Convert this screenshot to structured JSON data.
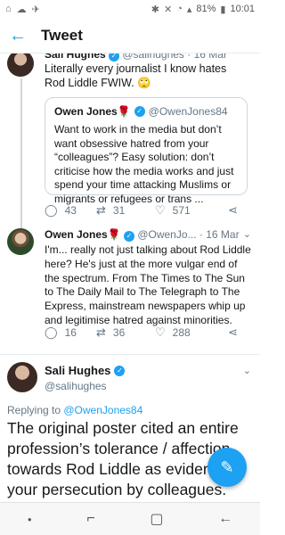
{
  "status_bar": {
    "left_icons": [
      "⌂",
      "☁",
      "✈"
    ],
    "battery": "81%",
    "time": "10:01"
  },
  "app_bar": {
    "title": "Tweet"
  },
  "tweets": [
    {
      "name": "Sali Hughes",
      "handle": "@salihughes",
      "time": "· 16 Mar",
      "text": "Literally every journalist I know hates Rod Liddle FWIW. 🙄",
      "quote": {
        "name": "Owen Jones🌹",
        "handle": "@OwenJones84",
        "text": "Want to work in the media but don’t want obsessive hatred from your “colleagues”? Easy solution: don’t criticise how the media works and just spend your time attacking Muslims or migrants or refugees or trans ..."
      },
      "replies": "43",
      "retweets": "31",
      "likes": "571"
    },
    {
      "name": "Owen Jones🌹",
      "handle": "@OwenJo...",
      "time": "· 16 Mar",
      "text": "I'm... really not just talking about Rod Liddle here? He's just at the more vulgar end of the spectrum. From The Times to The Sun to The Daily Mail to The Telegraph to The Express, mainstream newspapers whip up and legitimise hatred against minorities.",
      "replies": "16",
      "retweets": "36",
      "likes": "288"
    },
    {
      "name": "Sali Hughes",
      "handle": "@salihughes",
      "replying_prefix": "Replying to ",
      "replying_to": "@OwenJones84",
      "text": "The original poster cited an entire profession’s tolerance / affection towards Rod Liddle as evidence of your persecution by colleagues."
    }
  ],
  "icons": {
    "back": "arrow-left-icon",
    "reply": "reply-icon",
    "retweet": "retweet-icon",
    "like": "heart-icon",
    "share": "share-icon",
    "compose": "compose-icon"
  },
  "colors": {
    "accent": "#1da1f2",
    "text": "#14171a",
    "muted": "#657786"
  }
}
